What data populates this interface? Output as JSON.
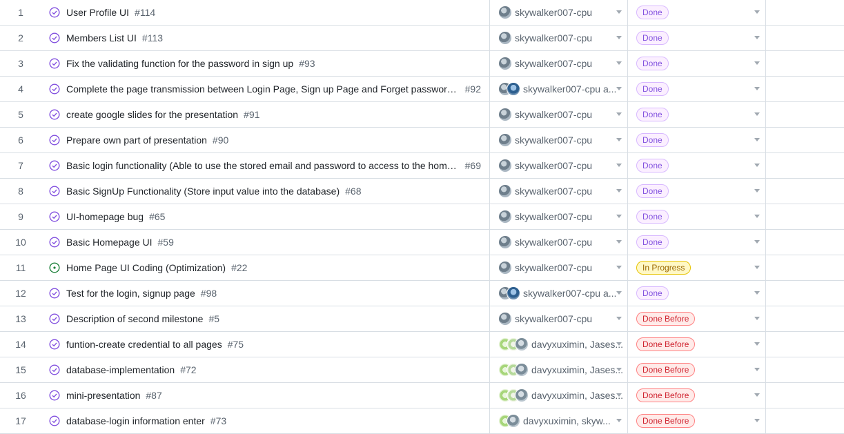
{
  "rows": [
    {
      "num": "1",
      "title": "User Profile UI",
      "issue": "#114",
      "assignee": "skywalker007-cpu",
      "status": "Done"
    },
    {
      "num": "2",
      "title": "Members List UI",
      "issue": "#113",
      "assignee": "skywalker007-cpu",
      "status": "Done"
    },
    {
      "num": "3",
      "title": "Fix the validating function for the password in sign up",
      "issue": "#93",
      "assignee": "skywalker007-cpu",
      "status": "Done"
    },
    {
      "num": "4",
      "title": "Complete the page transmission between Login Page, Sign up Page and Forget password ...",
      "issue": "#92",
      "assignee": "skywalker007-cpu a...",
      "status": "Done"
    },
    {
      "num": "5",
      "title": "create google slides for the presentation",
      "issue": "#91",
      "assignee": "skywalker007-cpu",
      "status": "Done"
    },
    {
      "num": "6",
      "title": "Prepare own part of presentation",
      "issue": "#90",
      "assignee": "skywalker007-cpu",
      "status": "Done"
    },
    {
      "num": "7",
      "title": "Basic login functionality (Able to use the stored email and password to access to the home...",
      "issue": "#69",
      "assignee": "skywalker007-cpu",
      "status": "Done"
    },
    {
      "num": "8",
      "title": "Basic SignUp Functionality (Store input value into the database)",
      "issue": "#68",
      "assignee": "skywalker007-cpu",
      "status": "Done"
    },
    {
      "num": "9",
      "title": "UI-homepage bug",
      "issue": "#65",
      "assignee": "skywalker007-cpu",
      "status": "Done"
    },
    {
      "num": "10",
      "title": "Basic Homepage UI",
      "issue": "#59",
      "assignee": "skywalker007-cpu",
      "status": "Done"
    },
    {
      "num": "11",
      "title": "Home Page UI Coding (Optimization)",
      "issue": "#22",
      "assignee": "skywalker007-cpu",
      "status": "In Progress"
    },
    {
      "num": "12",
      "title": "Test for the login, signup page",
      "issue": "#98",
      "assignee": "skywalker007-cpu a...",
      "status": "Done"
    },
    {
      "num": "13",
      "title": "Description of second milestone",
      "issue": "#5",
      "assignee": "skywalker007-cpu",
      "status": "Done Before"
    },
    {
      "num": "14",
      "title": "funtion-create credential to all pages",
      "issue": "#75",
      "assignee": "davyxuximin, Jases...",
      "status": "Done Before"
    },
    {
      "num": "15",
      "title": "database-implementation",
      "issue": "#72",
      "assignee": "davyxuximin, Jases...",
      "status": "Done Before"
    },
    {
      "num": "16",
      "title": "mini-presentation",
      "issue": "#87",
      "assignee": "davyxuximin, Jases...",
      "status": "Done Before"
    },
    {
      "num": "17",
      "title": "database-login information enter",
      "issue": "#73",
      "assignee": "davyxuximin, skyw...",
      "status": "Done Before"
    }
  ],
  "colors": {
    "done_purple": "#8250df",
    "open_green": "#1a7f37",
    "border": "#d8dee4"
  }
}
